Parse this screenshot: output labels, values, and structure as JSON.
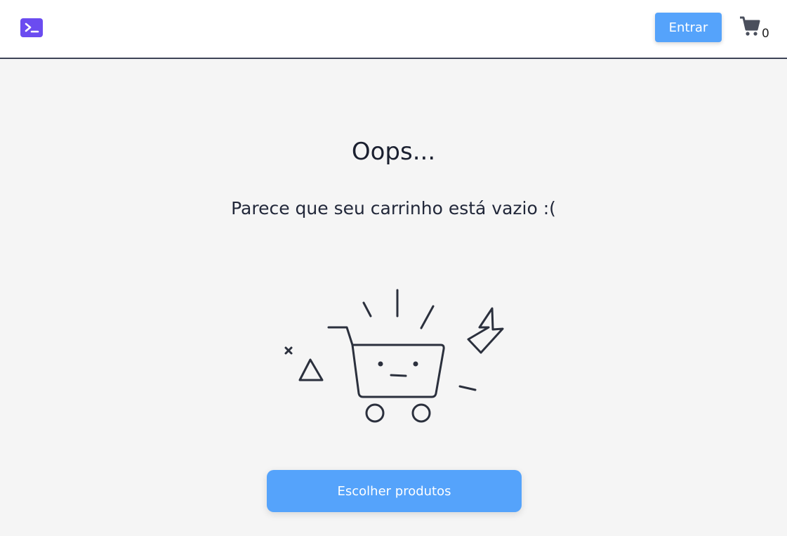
{
  "header": {
    "logo_icon": "terminal-icon",
    "login_label": "Entrar",
    "cart_icon": "shopping-cart-icon",
    "cart_count": "0"
  },
  "main": {
    "title": "Oops...",
    "message": "Parece que seu carrinho está vazio :(",
    "illustration_icon": "sad-empty-cart-icon",
    "cta_label": "Escolher produtos"
  },
  "colors": {
    "accent": "#55a3fb",
    "logo": "#6b4cf0",
    "background": "#f5f5f5",
    "text": "#1f2430"
  }
}
